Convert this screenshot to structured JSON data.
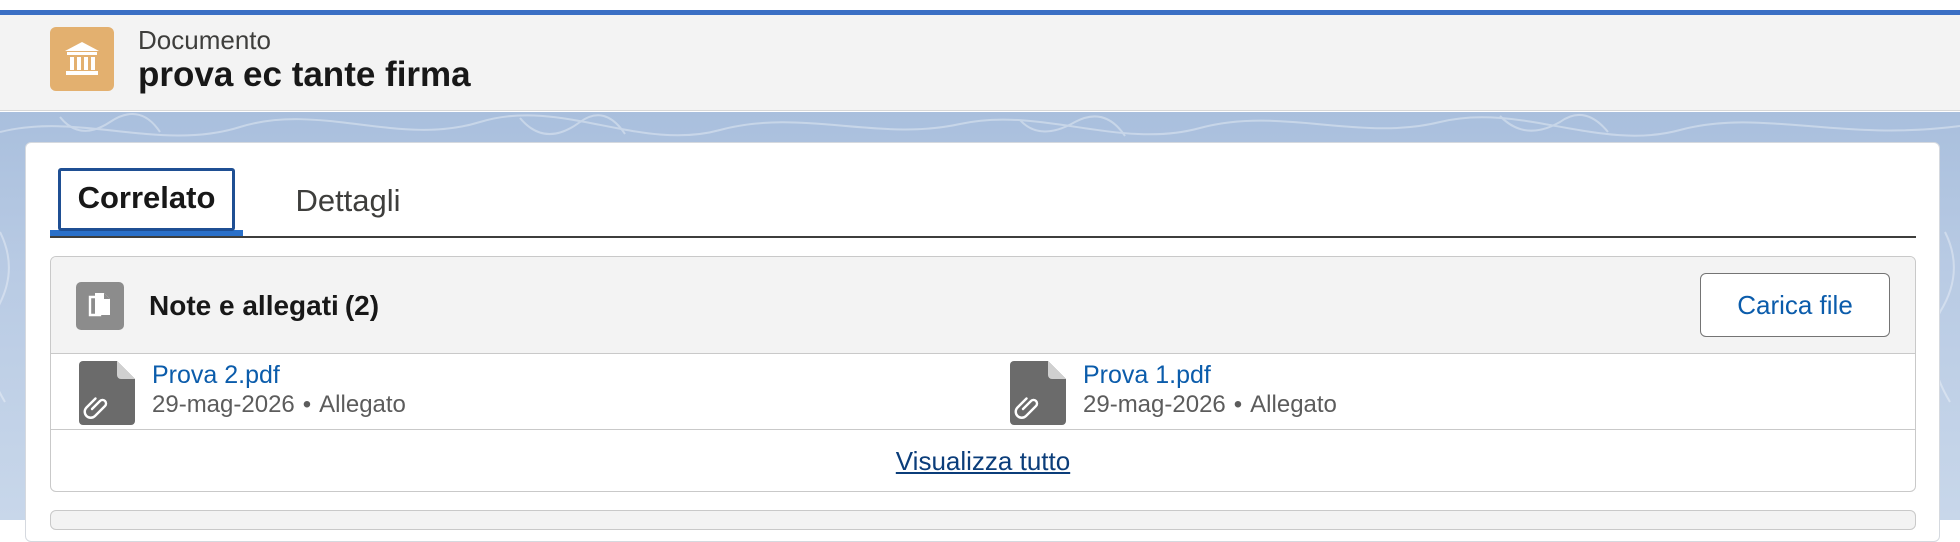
{
  "header": {
    "object_label": "Documento",
    "record_title": "prova ec tante firma",
    "icon": "bank-icon",
    "icon_color": "#e3b06f"
  },
  "tabs": [
    {
      "label": "Correlato",
      "active": true
    },
    {
      "label": "Dettagli",
      "active": false
    }
  ],
  "related_list": {
    "title": "Note e allegati",
    "count": "(2)",
    "icon": "files-icon",
    "upload_button_label": "Carica file",
    "items": [
      {
        "name": "Prova 2.pdf",
        "date": "29-mag-2026",
        "type": "Allegato",
        "icon": "attachment-file-icon"
      },
      {
        "name": "Prova 1.pdf",
        "date": "29-mag-2026",
        "type": "Allegato",
        "icon": "attachment-file-icon"
      }
    ],
    "view_all_label": "Visualizza tutto",
    "meta_separator": "•"
  },
  "colors": {
    "accent": "#2a70c9",
    "link": "#0b5cab",
    "top_bar": "#3a6fc4"
  }
}
